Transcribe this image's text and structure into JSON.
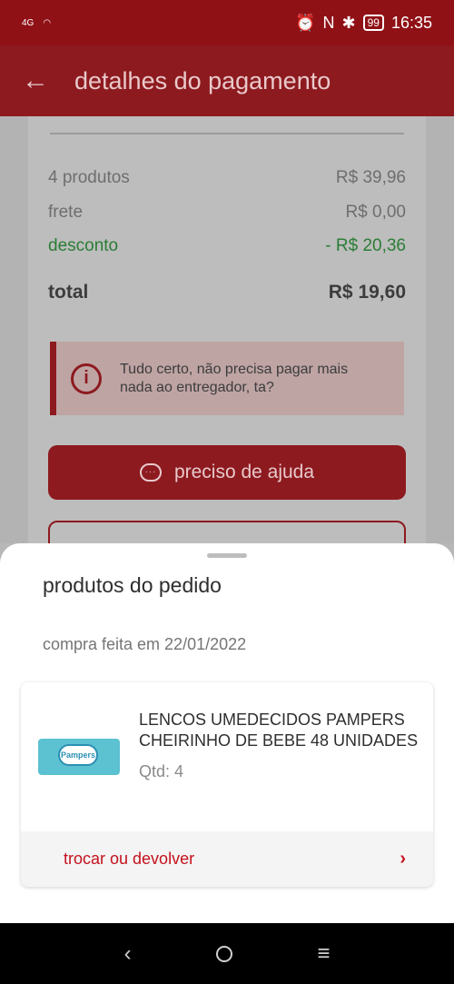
{
  "status": {
    "signal": "4G",
    "battery": "99",
    "time": "16:35"
  },
  "app_bar": {
    "title": "detalhes do pagamento"
  },
  "summary": {
    "products_label": "4 produtos",
    "products_value": "R$ 39,96",
    "shipping_label": "frete",
    "shipping_value": "R$ 0,00",
    "discount_label": "desconto",
    "discount_value": "- R$ 20,36",
    "total_label": "total",
    "total_value": "R$ 19,60",
    "colors": {
      "discount": "#2a7d35",
      "accent": "#c4111c"
    }
  },
  "alert": {
    "text": "Tudo certo, não precisa pagar mais nada ao entregador, ta?"
  },
  "help_button": {
    "label": "preciso de ajuda"
  },
  "sheet": {
    "title": "produtos do pedido",
    "date": "compra feita em 22/01/2022",
    "product": {
      "name": "LENCOS UMEDECIDOS PAMPERS CHEIRINHO DE BEBE 48 UNIDADES",
      "qty": "Qtd: 4",
      "brand": "Pampers"
    },
    "return_label": "trocar ou devolver"
  }
}
